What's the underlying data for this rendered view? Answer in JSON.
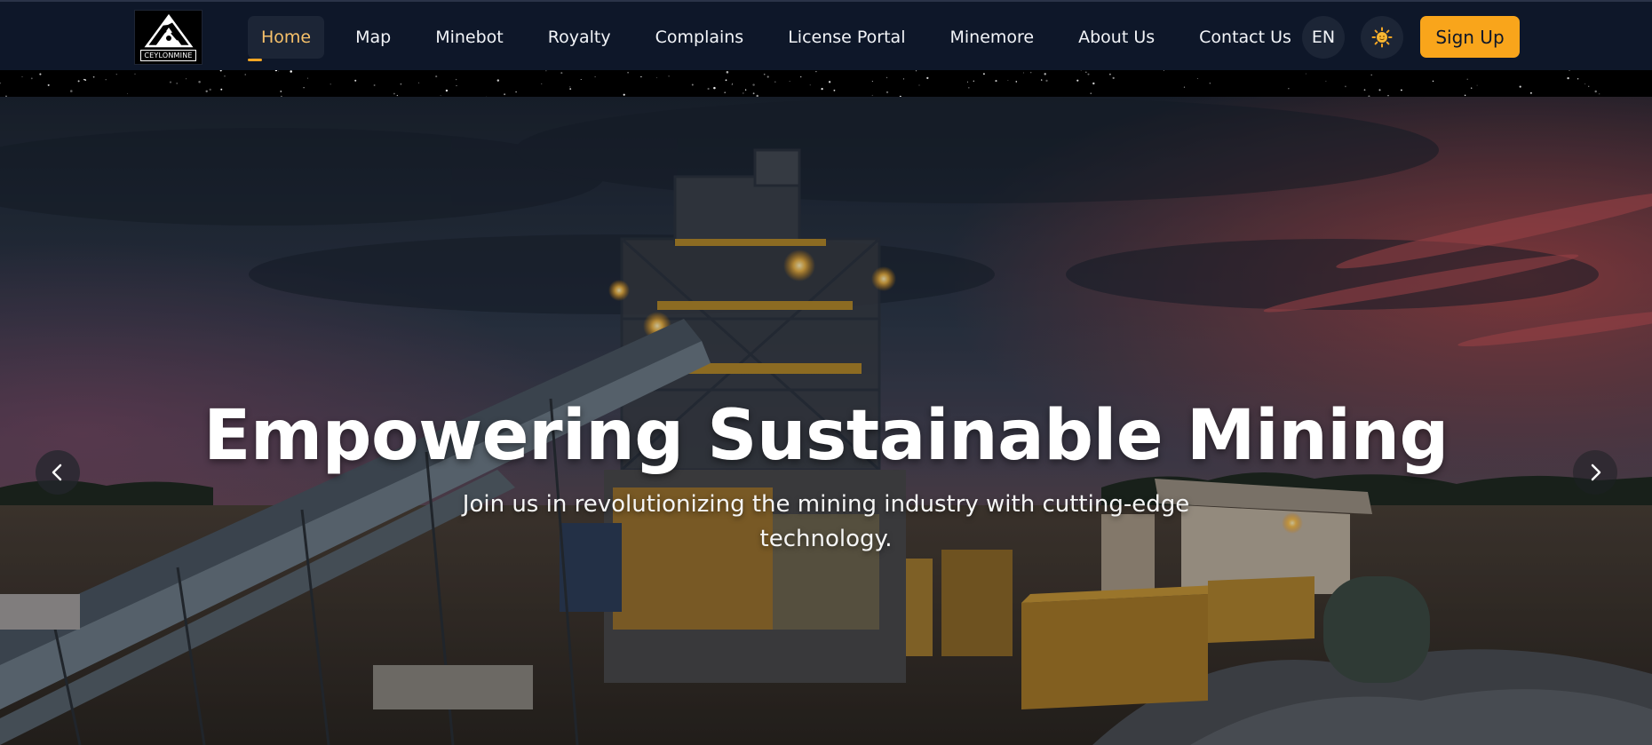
{
  "brand": {
    "logo_text": "CEYLONMINE"
  },
  "nav": {
    "items": [
      {
        "label": "Home",
        "active": true
      },
      {
        "label": "Map"
      },
      {
        "label": "Minebot"
      },
      {
        "label": "Royalty"
      },
      {
        "label": "Complains"
      },
      {
        "label": "License Portal"
      },
      {
        "label": "Minemore"
      },
      {
        "label": "About Us"
      },
      {
        "label": "Contact Us"
      }
    ],
    "language": "EN",
    "theme_icon": "sun-icon",
    "signup_label": "Sign Up"
  },
  "hero": {
    "title": "Empowering Sustainable Mining",
    "subtitle": "Join us in revolutionizing the mining industry with cutting-edge technology.",
    "prev_icon": "chevron-left-icon",
    "next_icon": "chevron-right-icon"
  },
  "colors": {
    "navbar_bg": "#0e1729",
    "accent": "#f9a51b",
    "active_link": "#f7c16a"
  }
}
